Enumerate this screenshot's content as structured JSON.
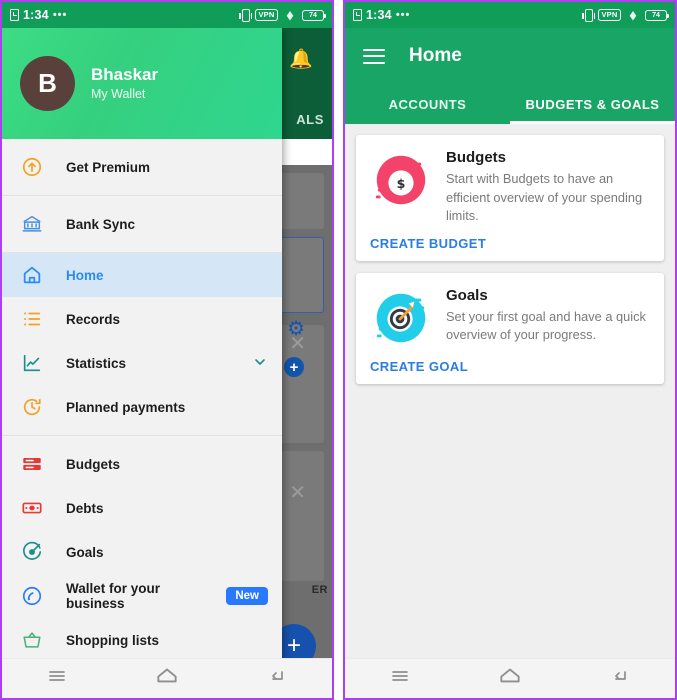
{
  "status_bar": {
    "time": "1:34",
    "dots": "•••",
    "alarm_icon": "alarm-icon",
    "vibrate_icon": "vibrate-icon",
    "vpn_label": "VPN",
    "wifi_icon": "wifi-icon",
    "battery_level": "74"
  },
  "left_phone": {
    "drawer": {
      "profile": {
        "avatar_initial": "B",
        "name": "Bhaskar",
        "subtitle": "My Wallet"
      },
      "groups": [
        {
          "items": [
            {
              "label": "Get Premium",
              "icon": "arrow-up-circle-icon",
              "color": "#f5a021",
              "active": false,
              "badge": null,
              "chevron": false
            }
          ]
        },
        {
          "items": [
            {
              "label": "Bank Sync",
              "icon": "bank-icon",
              "color": "#4a90e2",
              "active": false,
              "badge": null,
              "chevron": false
            }
          ]
        },
        {
          "items": [
            {
              "label": "Home",
              "icon": "home-icon",
              "color": "#2b8cf0",
              "active": true,
              "badge": null,
              "chevron": false
            },
            {
              "label": "Records",
              "icon": "list-icon",
              "color": "#f5a021",
              "active": false,
              "badge": null,
              "chevron": false
            },
            {
              "label": "Statistics",
              "icon": "chart-line-icon",
              "color": "#1b8f8b",
              "active": false,
              "badge": null,
              "chevron": true
            },
            {
              "label": "Planned payments",
              "icon": "clock-refresh-icon",
              "color": "#f5a021",
              "active": false,
              "badge": null,
              "chevron": false
            }
          ]
        },
        {
          "items": [
            {
              "label": "Budgets",
              "icon": "budget-bars-icon",
              "color": "#e53935",
              "active": false,
              "badge": null,
              "chevron": false
            },
            {
              "label": "Debts",
              "icon": "banknote-icon",
              "color": "#e53935",
              "active": false,
              "badge": null,
              "chevron": false
            },
            {
              "label": "Goals",
              "icon": "target-icon",
              "color": "#1b8f8b",
              "active": false,
              "badge": null,
              "chevron": false
            },
            {
              "label": "Wallet for your business",
              "icon": "speedometer-icon",
              "color": "#2979ff",
              "active": false,
              "badge": "New",
              "chevron": false
            },
            {
              "label": "Shopping lists",
              "icon": "basket-icon",
              "color": "#4caf7d",
              "active": false,
              "badge": null,
              "chevron": false
            }
          ]
        }
      ]
    },
    "background_app": {
      "tab_text_fragment": "ALS",
      "label_fragment": "ER",
      "bell_icon": "bell-icon",
      "gear_icon": "gear-icon",
      "plus_icon": "plus-circle-icon",
      "close_icon": "close-icon",
      "fab_icon": "plus-icon"
    },
    "nav_bar": {
      "recents_icon": "recents-icon",
      "home_icon": "home-nav-icon",
      "back_icon": "back-icon"
    }
  },
  "right_phone": {
    "app_bar": {
      "menu_icon": "hamburger-menu-icon",
      "title": "Home"
    },
    "tabs": [
      {
        "label": "ACCOUNTS",
        "selected": false
      },
      {
        "label": "BUDGETS & GOALS",
        "selected": true
      }
    ],
    "cards": [
      {
        "icon": "money-bag-icon",
        "icon_color": "#f4436a",
        "title": "Budgets",
        "description": "Start with Budgets to have an efficient overview of your spending limits.",
        "action": "CREATE BUDGET",
        "action_color": "#2b7de0"
      },
      {
        "icon": "target-dart-icon",
        "icon_color": "#22cdea",
        "title": "Goals",
        "description": "Set your first goal and have a quick overview of your progress.",
        "action": "CREATE GOAL",
        "action_color": "#2b7de0"
      }
    ],
    "nav_bar": {
      "recents_icon": "recents-icon",
      "home_icon": "home-nav-icon",
      "back_icon": "back-icon"
    }
  }
}
